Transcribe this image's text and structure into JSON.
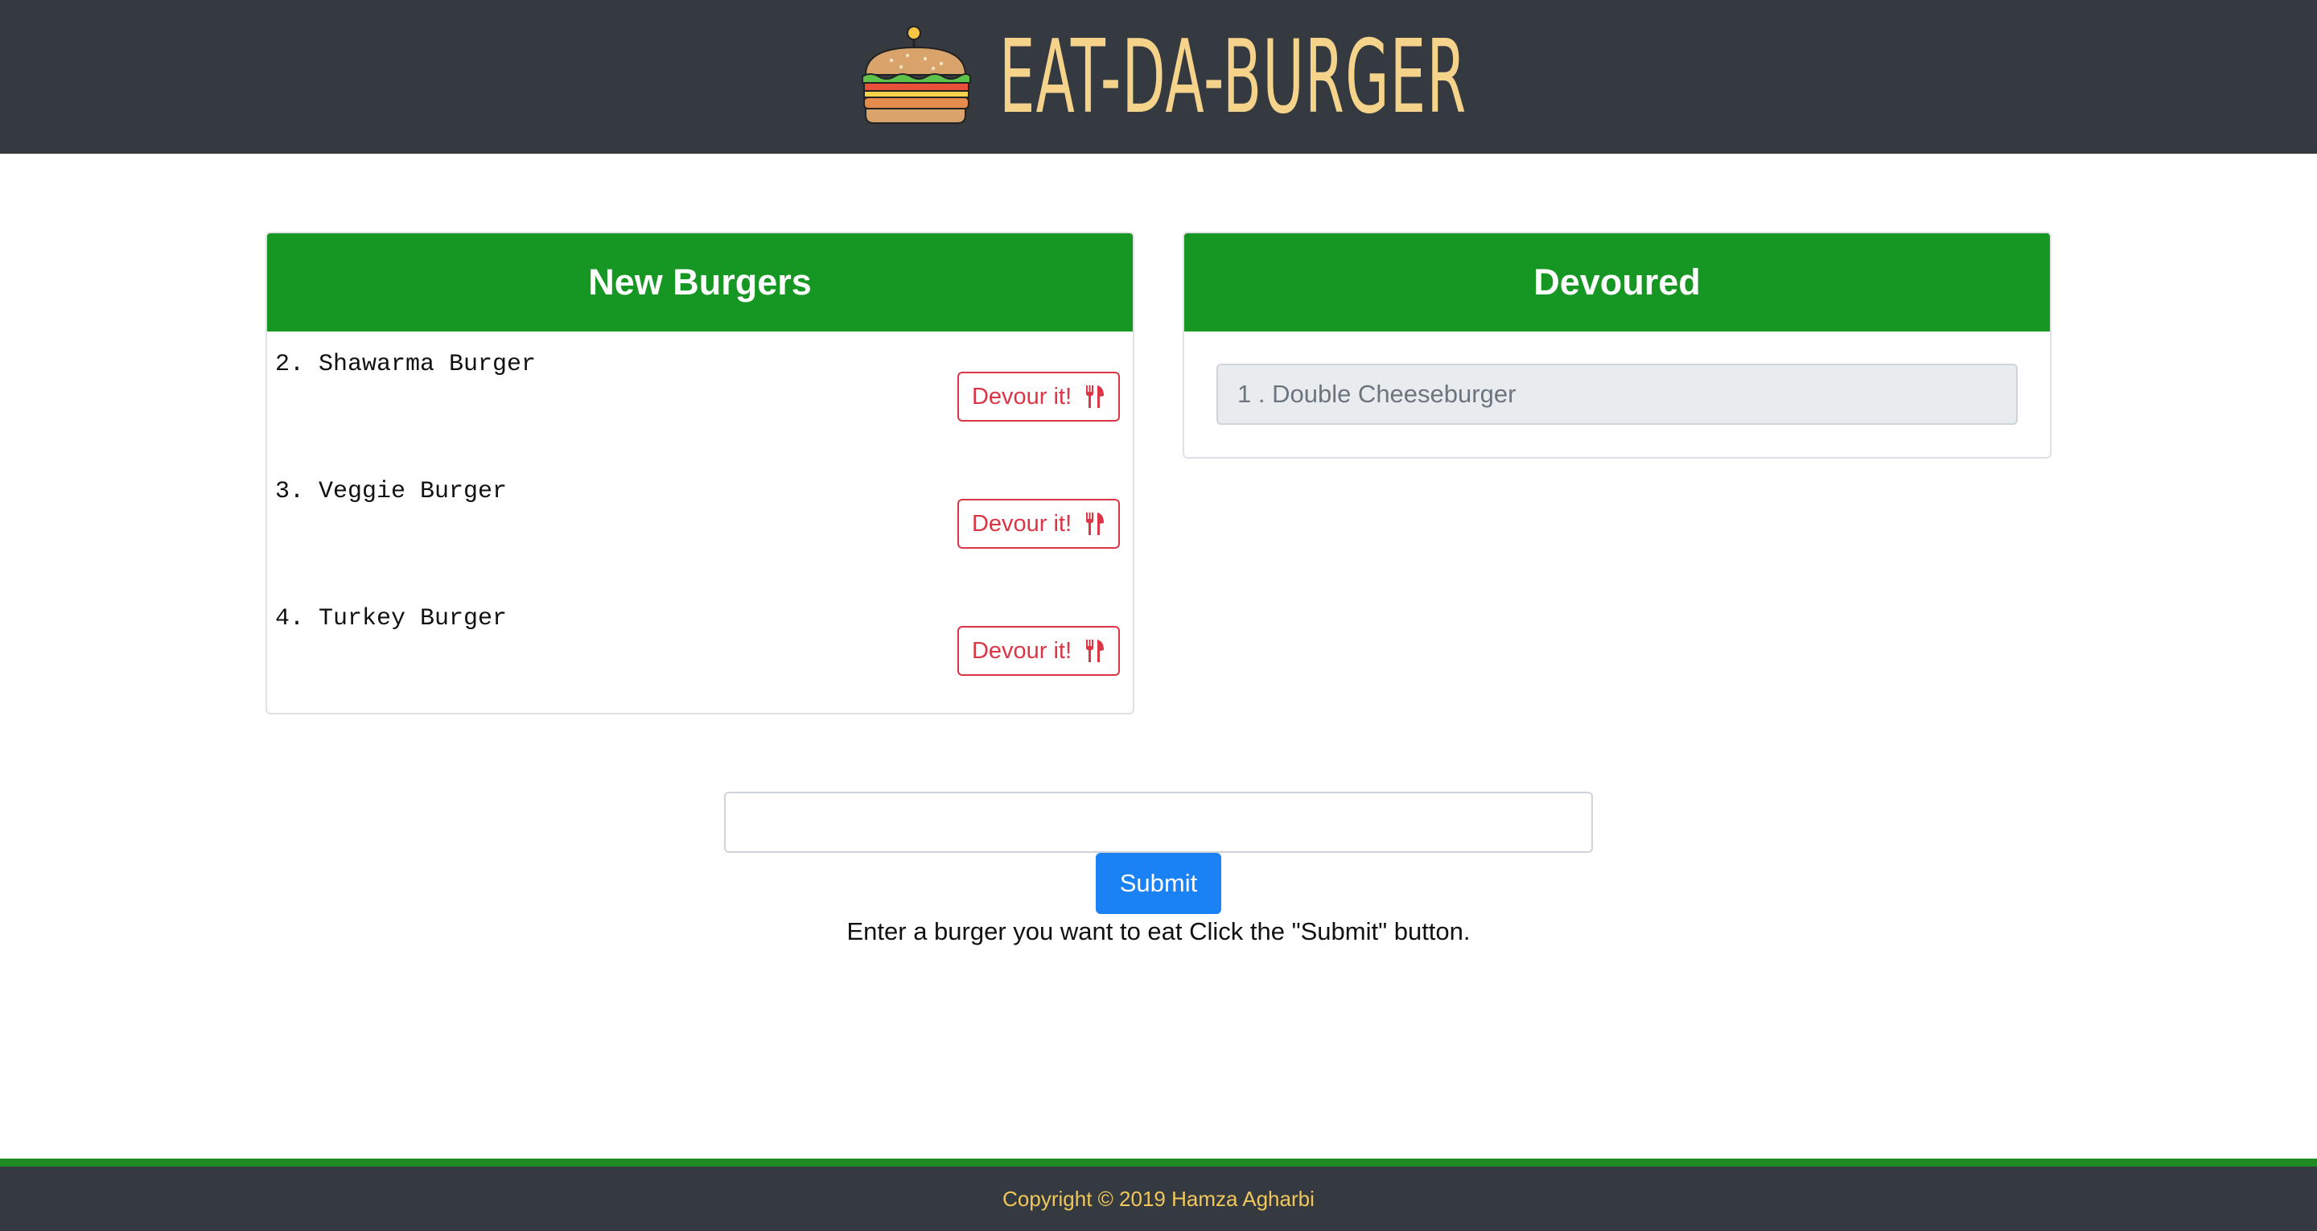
{
  "header": {
    "title": "EAT-DA-BURGER",
    "logo_icon": "burger-icon"
  },
  "new_burgers": {
    "title": "New Burgers",
    "items": [
      {
        "label": "2. Shawarma Burger",
        "button_label": "Devour it!",
        "button_icon": "utensils-icon"
      },
      {
        "label": "3. Veggie Burger",
        "button_label": "Devour it!",
        "button_icon": "utensils-icon"
      },
      {
        "label": "4. Turkey Burger",
        "button_label": "Devour it!",
        "button_icon": "utensils-icon"
      }
    ]
  },
  "devoured": {
    "title": "Devoured",
    "items": [
      {
        "label": "1 . Double Cheeseburger"
      }
    ]
  },
  "form": {
    "input_value": "",
    "input_placeholder": "",
    "submit_label": "Submit",
    "instructions": "Enter a burger you want to eat Click the \"Submit\" button."
  },
  "footer": {
    "copyright": "Copyright © 2019 Hamza Agharbi"
  },
  "colors": {
    "header_bg": "#343a40",
    "title_color": "#f6d38a",
    "card_header_bg": "#169622",
    "devour_button": "#dc3545",
    "submit_button": "#1a82f5",
    "footer_text": "#f1c75b",
    "footer_stripe": "#1f8a21"
  }
}
